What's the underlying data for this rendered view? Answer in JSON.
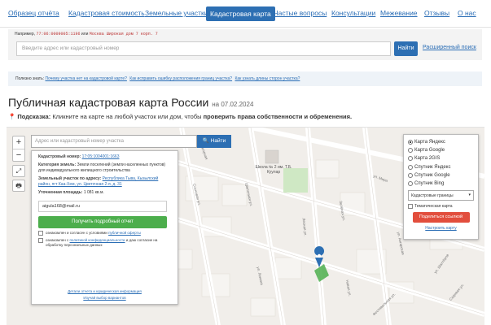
{
  "nav": {
    "items": [
      {
        "label": "Образец отчёта",
        "active": false
      },
      {
        "label": "Кадастровая стоимость",
        "active": false
      },
      {
        "label": "Земельные участки",
        "active": false
      },
      {
        "label": "Кадастровая карта",
        "active": true
      },
      {
        "label": "Частые вопросы",
        "active": false
      },
      {
        "label": "Консультации",
        "active": false
      },
      {
        "label": "Межевание",
        "active": false
      },
      {
        "label": "Отзывы",
        "active": false
      },
      {
        "label": "О нас",
        "active": false
      }
    ]
  },
  "search": {
    "example_prefix": "Например,",
    "example_number": "77:06:0009005:1196",
    "example_or": "или",
    "example_address": "Москва Широкая дом 7 корп. 7",
    "placeholder": "Введите адрес или кадастровый номер",
    "button": "Найти",
    "advanced": "Расширенный поиск"
  },
  "useful": {
    "label": "Полезно знать:",
    "links": [
      "Почему участка нет на кадастровой карте?",
      "Как исправить ошибку расположения границ участка?",
      "Как узнать длины сторон участка?"
    ]
  },
  "page": {
    "title": "Публичная кадастровая карта России",
    "date_prefix": "на",
    "date": "07.02.2024",
    "hint_label": "Подсказка:",
    "hint_text": "Кликните на карте на любой участок или дом, чтобы",
    "hint_bold": "проверить права собственности и обременения."
  },
  "map": {
    "zoom_in": "+",
    "zoom_out": "−",
    "search_placeholder": "Адрес или кадастровый номер участка",
    "search_button": "Найти",
    "school_label": "Школа № 2 им. Т.Б. Куулар",
    "streets": [
      "ул. Нагорная",
      "Цветочная ул.",
      "Лесная ул.",
      "Сосновая ул.",
      "Зелёная ул.",
      "ул. Мира",
      "ул. Шахтёров",
      "Новая ул.",
      "Фестивальная ул.",
      "Садовая ул.",
      "ул. Ангарская",
      "ул. Ленина"
    ]
  },
  "info": {
    "cad_number_label": "Кадастровый номер:",
    "cad_number": "17:05:1004001:1663",
    "category_label": "Категория земель:",
    "category": "Земли поселений (земли населенных пунктов)",
    "usage": "для индивидуального жилищного строительства",
    "address_label": "Земельный участок по адресу:",
    "address": "Республика Тыва, Кызылский район, пгт Каа-Хем, ул. Цветочная 2-я, д. 31",
    "area_label": "Уточненная площадь:",
    "area": "1 081 кв.м.",
    "email": "aigula168@mail.ru",
    "report_button": "Получить подробный отчет",
    "check1_text": "ознакомлен и согласен с условиями",
    "check1_link": "публичной оферты",
    "check2_text": "ознакомлен с",
    "check2_link": "политикой конфиденциальности",
    "check2_tail": "и даю согласие на обработку персональных данных",
    "details_link": "Детали отчета и юридическая информация",
    "variants_link": "Изучай выбор вариантов"
  },
  "layers": {
    "options": [
      {
        "label": "Карта Яндекс",
        "selected": true
      },
      {
        "label": "Карта Google",
        "selected": false
      },
      {
        "label": "Карта 2GIS",
        "selected": false
      },
      {
        "label": "Спутник Яндекс",
        "selected": false
      },
      {
        "label": "Спутник Google",
        "selected": false
      },
      {
        "label": "Спутник Bing",
        "selected": false
      }
    ],
    "select_value": "Кадастровые границы",
    "thematic": "Тематическая карта",
    "share": "Поделиться ссылкой",
    "configure": "Настроить карту"
  },
  "colors": {
    "accent": "#2d6fb3",
    "link": "#2a6db5",
    "green": "#4cae4c",
    "red": "#e24e3d",
    "map_bg": "#f1eeea"
  }
}
